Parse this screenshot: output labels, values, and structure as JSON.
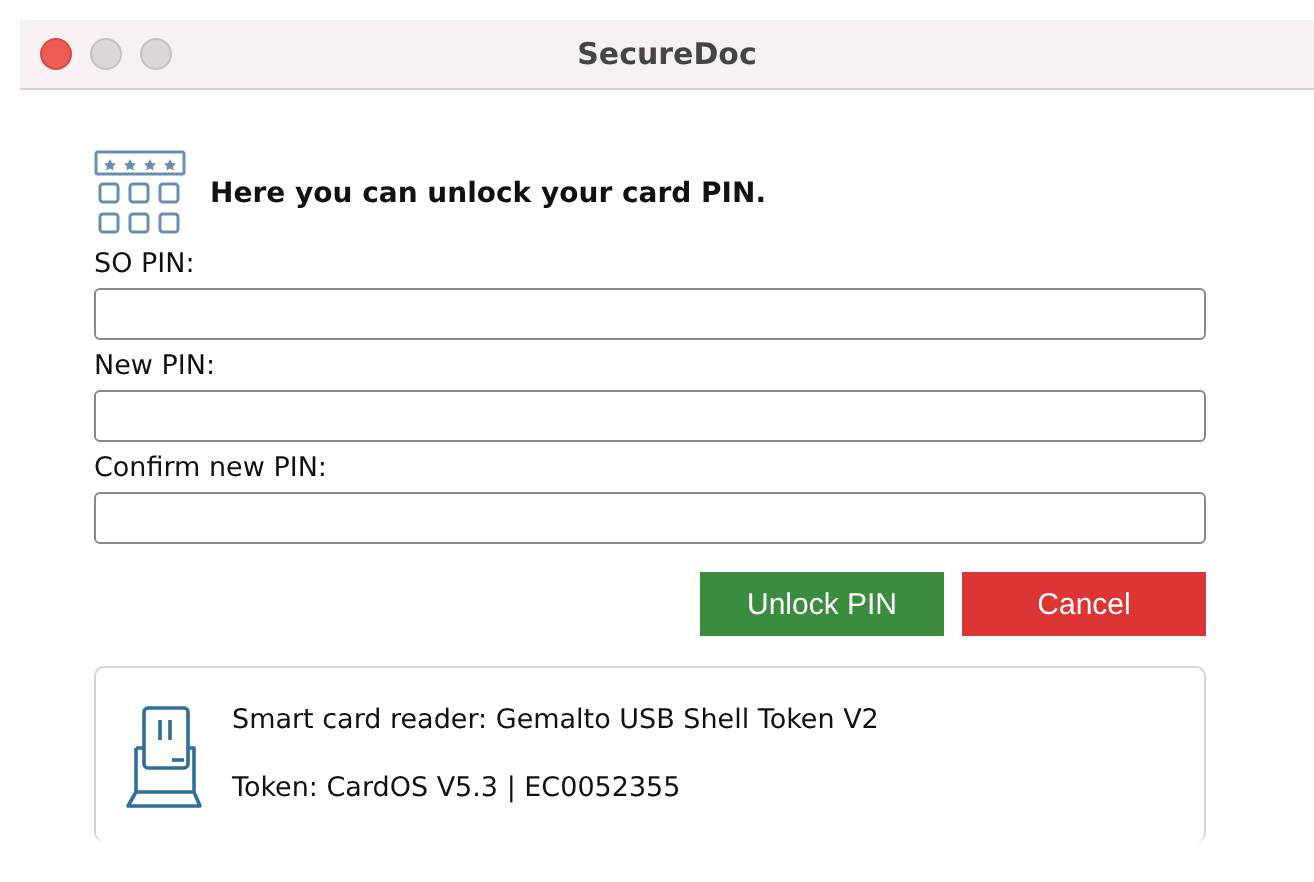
{
  "window": {
    "title": "SecureDoc"
  },
  "heading": "Here you can unlock your card PIN.",
  "fields": [
    {
      "label": "SO PIN:"
    },
    {
      "label": "New PIN:"
    },
    {
      "label": "Confirm new PIN:"
    }
  ],
  "buttons": [
    {
      "label": "Unlock PIN",
      "kind": "primary"
    },
    {
      "label": "Cancel",
      "kind": "danger"
    }
  ],
  "info": [
    "Smart card reader: Gemalto USB Shell Token V2",
    "Token: CardOS V5.3 | EC0052355"
  ]
}
